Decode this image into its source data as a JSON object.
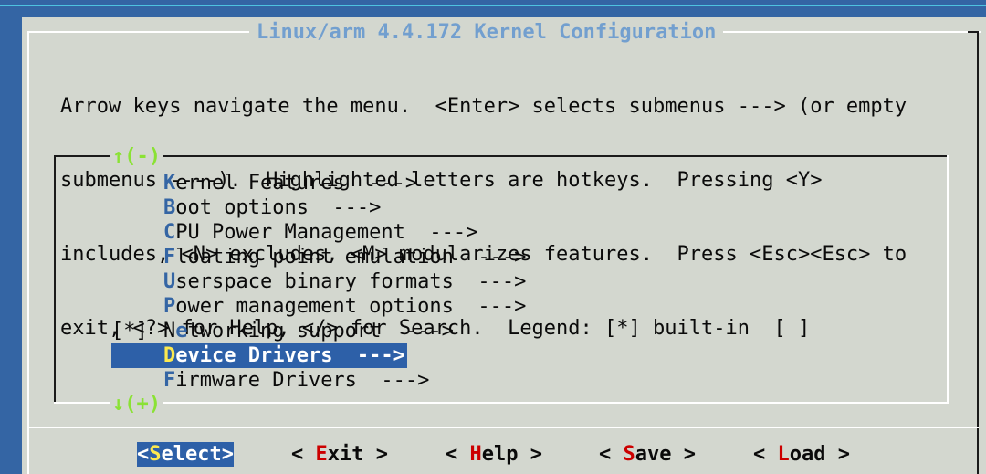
{
  "title": "Linux/arm 4.4.172 Kernel Configuration",
  "help_lines": [
    "Arrow keys navigate the menu.  <Enter> selects submenus ---> (or empty",
    "submenus ----).  Highlighted letters are hotkeys.  Pressing <Y>",
    "includes, <N> excludes, <M> modularizes features.  Press <Esc><Esc> to",
    "exit, <?> for Help, </> for Search.  Legend: [*] built-in  [ ]"
  ],
  "scroll_up": "↑(-)",
  "scroll_down": "↓(+)",
  "menu_items": [
    {
      "mark": "",
      "hotkey": "K",
      "rest": "ernel Features  --->",
      "selected": false
    },
    {
      "mark": "",
      "hotkey": "B",
      "rest": "oot options  --->",
      "selected": false
    },
    {
      "mark": "",
      "hotkey": "C",
      "rest": "PU Power Management  --->",
      "selected": false
    },
    {
      "mark": "",
      "hotkey": "F",
      "rest": "loating point emulation  --->",
      "selected": false
    },
    {
      "mark": "",
      "hotkey": "U",
      "rest": "serspace binary formats  --->",
      "selected": false
    },
    {
      "mark": "",
      "hotkey": "P",
      "rest": "ower management options  --->",
      "selected": false
    },
    {
      "mark": "[*]",
      "prefix": "N",
      "hotkey": "e",
      "rest": "tworking support  --->",
      "selected": false
    },
    {
      "mark": "",
      "hotkey": "D",
      "rest": "evice Drivers  --->",
      "selected": true
    },
    {
      "mark": "",
      "hotkey": "F",
      "rest": "irmware Drivers  --->",
      "selected": false
    }
  ],
  "buttons": [
    {
      "open": "<",
      "hotkey": "S",
      "rest": "elect",
      "close": ">",
      "active": true
    },
    {
      "open": "< ",
      "hotkey": "E",
      "rest": "xit",
      "close": " >",
      "active": false
    },
    {
      "open": "< ",
      "hotkey": "H",
      "rest": "elp",
      "close": " >",
      "active": false
    },
    {
      "open": "< ",
      "hotkey": "S",
      "rest": "ave",
      "close": " >",
      "active": false
    },
    {
      "open": "< ",
      "hotkey": "L",
      "rest": "oad",
      "close": " >",
      "active": false
    }
  ],
  "colors": {
    "background": "#3465a4",
    "dialog": "#d3d7cf",
    "title": "#729fcf",
    "hotkey": "#3465a4",
    "selection": "#2d60a8",
    "scroll_indicator": "#8ae234",
    "button_hotkey": "#cc0000"
  }
}
